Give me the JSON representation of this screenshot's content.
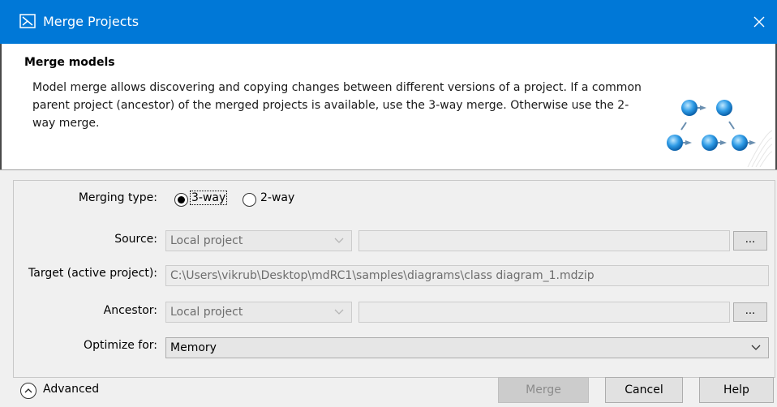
{
  "window": {
    "title": "Merge Projects",
    "accent_color": "#0078d7",
    "app_icon": "diagram-app-icon",
    "close_icon": "close-icon"
  },
  "header": {
    "title": "Merge models",
    "description": "Model merge allows discovering and copying changes between different versions of a project. If a common parent project (ancestor) of the merged projects is available, use the 3-way merge. Otherwise use the 2-way merge.",
    "graphic_icon": "merge-flow-graphic"
  },
  "form": {
    "merging_type": {
      "label": "Merging type:",
      "options": [
        "3-way",
        "2-way"
      ],
      "selected": "3-way"
    },
    "source": {
      "label": "Source:",
      "combo_value": "Local project",
      "path_value": "",
      "browse_label": "..."
    },
    "target": {
      "label": "Target (active project):",
      "value": "C:\\Users\\vikrub\\Desktop\\mdRC1\\samples\\diagrams\\class diagram_1.mdzip"
    },
    "ancestor": {
      "label": "Ancestor:",
      "combo_value": "Local project",
      "path_value": "",
      "browse_label": "..."
    },
    "optimize": {
      "label": "Optimize for:",
      "value": "Memory"
    }
  },
  "footer": {
    "advanced_label": "Advanced",
    "merge_label": "Merge",
    "cancel_label": "Cancel",
    "help_label": "Help"
  }
}
